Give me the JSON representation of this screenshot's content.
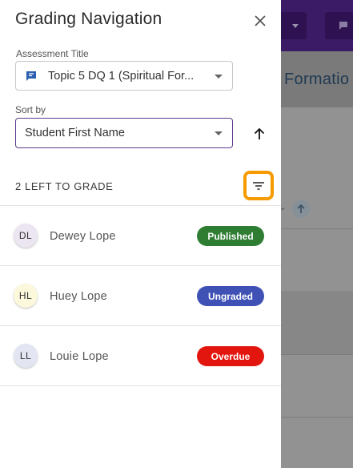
{
  "drawer": {
    "title": "Grading Navigation",
    "assessment_label": "Assessment Title",
    "assessment_value": "Topic 5 DQ 1 (Spiritual For...",
    "sort_label": "Sort by",
    "sort_value": "Student First Name",
    "left_to_grade": "2 LEFT TO GRADE"
  },
  "students": [
    {
      "initials": "DL",
      "name": "Dewey Lope",
      "status": "Published",
      "status_color": "#2e7d32",
      "avatar_bg": "#ebe6f2"
    },
    {
      "initials": "HL",
      "name": "Huey Lope",
      "status": "Ungraded",
      "status_color": "#3f51b5",
      "avatar_bg": "#fbf8dc"
    },
    {
      "initials": "LL",
      "name": "Louie Lope",
      "status": "Overdue",
      "status_color": "#e3150f",
      "avatar_bg": "#e3e5f3"
    }
  ],
  "background": {
    "page_title": "Formatio"
  },
  "colors": {
    "accent_orange": "#f59a00",
    "focus_purple": "#5d3a8c",
    "topbar_purple": "#3b1a66"
  },
  "icons": {
    "close": "close-icon",
    "assessment": "discussion-icon",
    "sort_direction": "arrow-up-icon",
    "filter": "filter-icon"
  }
}
